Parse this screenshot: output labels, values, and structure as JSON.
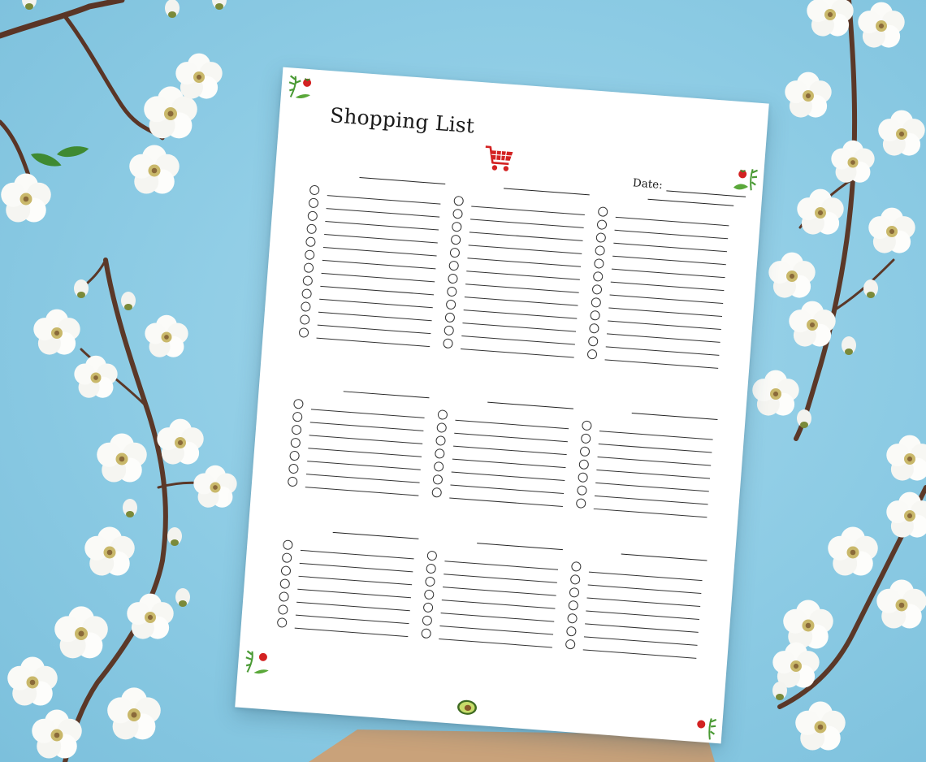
{
  "image": {
    "background_color": "#8fcbe3",
    "paper_color": "#ffffff",
    "accent_red": "#d32222",
    "leaf_green": "#5aa83a"
  },
  "shopping_list": {
    "title": "Shopping List",
    "date_label": "Date:",
    "cart_icon": "shopping-cart-icon",
    "footer_icon": "avocado-icon",
    "corner_icon": "strawberry-leaf-icon",
    "blocks": [
      {
        "row": 1,
        "column": 1,
        "items": 12
      },
      {
        "row": 1,
        "column": 2,
        "items": 12
      },
      {
        "row": 1,
        "column": 3,
        "items": 12
      },
      {
        "row": 2,
        "column": 1,
        "items": 7
      },
      {
        "row": 2,
        "column": 2,
        "items": 7
      },
      {
        "row": 2,
        "column": 3,
        "items": 7
      },
      {
        "row": 3,
        "column": 1,
        "items": 7
      },
      {
        "row": 3,
        "column": 2,
        "items": 7
      },
      {
        "row": 3,
        "column": 3,
        "items": 7
      }
    ]
  },
  "decor": {
    "flowers": "white-blossom-icon",
    "branches": "cherry-branch"
  }
}
